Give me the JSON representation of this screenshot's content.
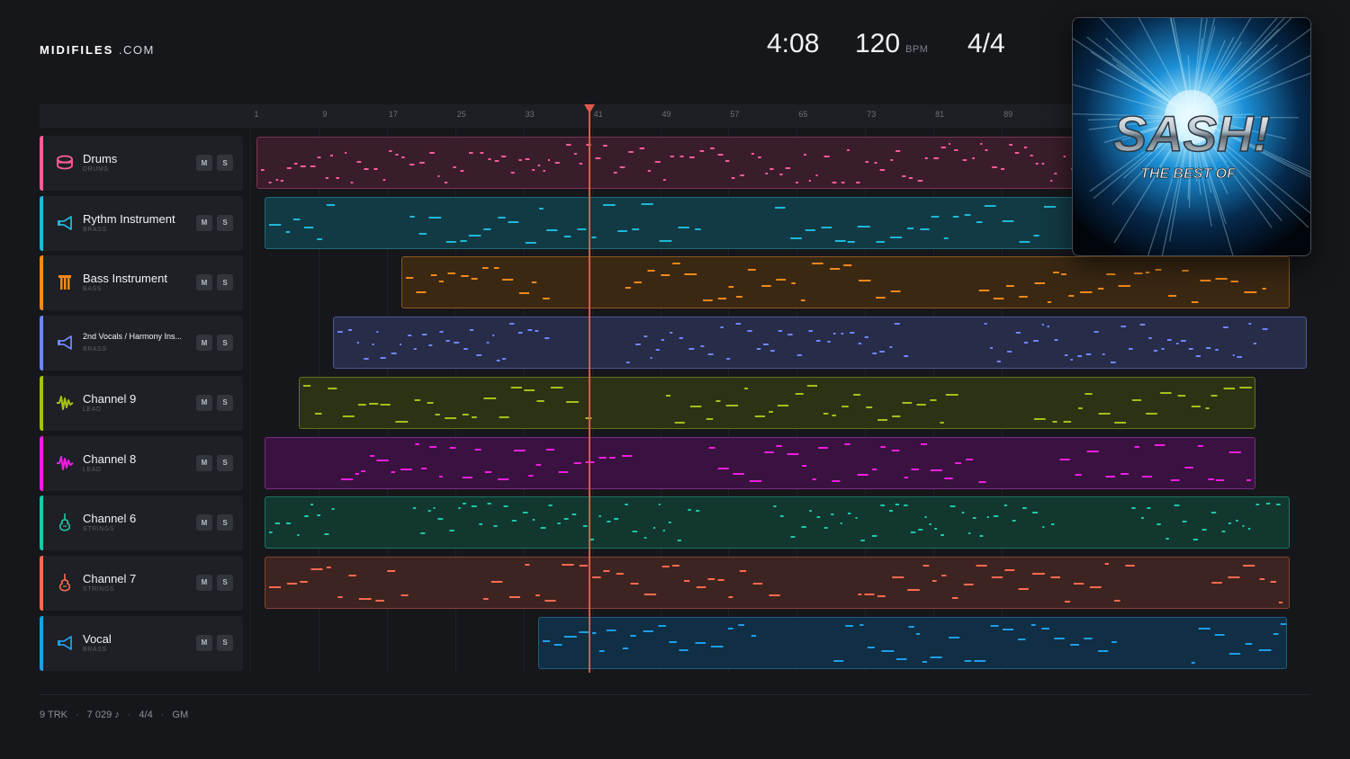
{
  "logo": {
    "bold": "MIDIFILES",
    "light": ".COM"
  },
  "stats": {
    "time": "4:08",
    "bpm_value": "120",
    "bpm_unit": "BPM",
    "signature": "4/4"
  },
  "album": {
    "artist": "SASH!",
    "title": "THE BEST OF"
  },
  "ruler_ticks": [
    "1",
    "9",
    "17",
    "25",
    "33",
    "41",
    "49",
    "57",
    "65",
    "73",
    "81",
    "89"
  ],
  "buttons": {
    "mute": "M",
    "solo": "S"
  },
  "tracks": [
    {
      "name": "Drums",
      "category": "DRUMS",
      "color": "#ff5c9a",
      "icon": "drum-icon",
      "clip_bg": "#3a1d2b",
      "clip_border": "#7a3552",
      "clip_start": 1,
      "clip_end": 200
    },
    {
      "name": "Rythm Instrument",
      "category": "BRASS",
      "color": "#1fb8d9",
      "icon": "trumpet-icon",
      "clip_bg": "#123a44",
      "clip_border": "#1f6a7a",
      "clip_start": 2,
      "clip_end": 200
    },
    {
      "name": "Bass Instrument",
      "category": "BASS",
      "color": "#f08a1c",
      "icon": "bass-icon",
      "clip_bg": "#3b2813",
      "clip_border": "#8a5a22",
      "clip_start": 18,
      "clip_end": 122
    },
    {
      "name": "2nd Vocals / Harmony Ins...",
      "category": "BRASS",
      "color": "#6f86ff",
      "icon": "trumpet-icon",
      "clip_bg": "#272c48",
      "clip_border": "#4d5a9a",
      "clip_start": 10,
      "clip_end": 124
    },
    {
      "name": "Channel 9",
      "category": "LEAD",
      "color": "#a5bf1a",
      "icon": "waveform-icon",
      "clip_bg": "#2c3214",
      "clip_border": "#63731e",
      "clip_start": 6,
      "clip_end": 118
    },
    {
      "name": "Channel 8",
      "category": "LEAD",
      "color": "#f01ee0",
      "icon": "waveform-icon",
      "clip_bg": "#3a1240",
      "clip_border": "#7d2a88",
      "clip_start": 2,
      "clip_end": 118
    },
    {
      "name": "Channel 6",
      "category": "STRINGS",
      "color": "#1dc9a8",
      "icon": "violin-icon",
      "clip_bg": "#12372f",
      "clip_border": "#1f7564",
      "clip_start": 2,
      "clip_end": 122
    },
    {
      "name": "Channel 7",
      "category": "STRINGS",
      "color": "#ff6a52",
      "icon": "violin-icon",
      "clip_bg": "#3d2420",
      "clip_border": "#86443a",
      "clip_start": 2,
      "clip_end": 122
    },
    {
      "name": "Vocal",
      "category": "BRASS",
      "color": "#1e9ee8",
      "icon": "trumpet-icon",
      "clip_bg": "#102e44",
      "clip_border": "#1f5d85",
      "clip_start": 34,
      "clip_end": 121.7
    }
  ],
  "playhead_bar": 41,
  "footer": {
    "tracks": "9 TRK",
    "notes": "7 029 ♪",
    "signature": "4/4",
    "standard": "GM"
  }
}
